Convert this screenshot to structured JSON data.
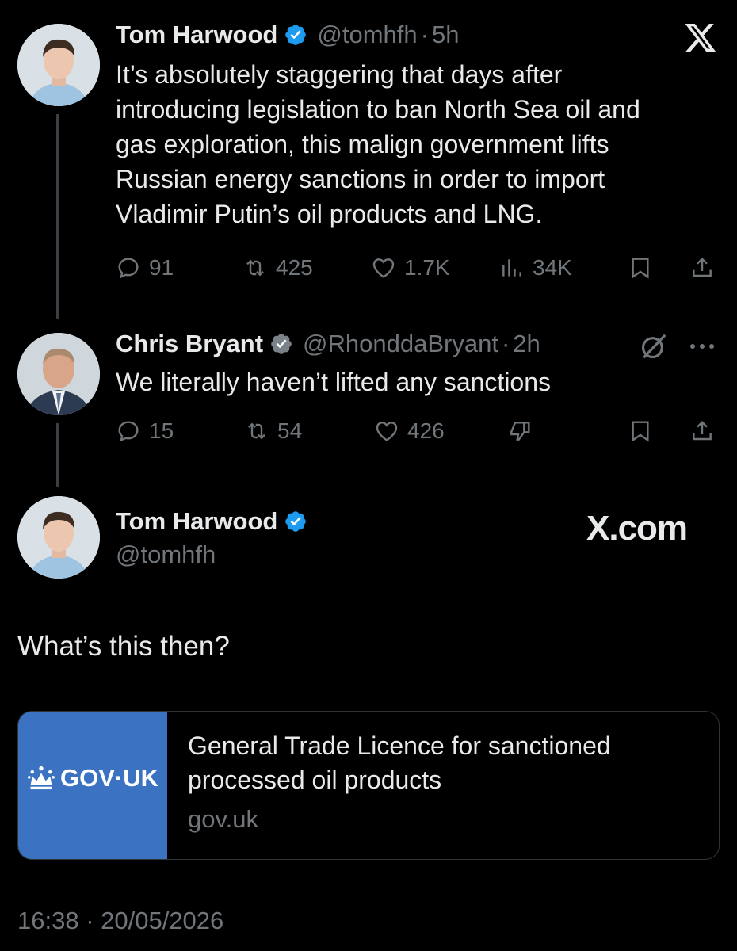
{
  "tweet1": {
    "name": "Tom Harwood",
    "handle": "@tomhfh",
    "time": "5h",
    "text_lines": [
      "It’s absolutely staggering that days after",
      "introducing legislation to ban North Sea oil and",
      "gas exploration, this malign government lifts",
      "Russian energy sanctions in order to import",
      "Vladimir Putin’s oil products and LNG."
    ],
    "replies": "91",
    "reposts": "425",
    "likes": "1.7K",
    "views": "34K"
  },
  "tweet2": {
    "name": "Chris Bryant",
    "handle": "@RhonddaBryant",
    "time": "2h",
    "text": "We literally haven’t lifted any sanctions",
    "replies": "15",
    "reposts": "54",
    "likes": "426"
  },
  "tweet3": {
    "name": "Tom Harwood",
    "handle": "@tomhfh",
    "watermark": "X.com",
    "text": "What’s this then?",
    "card": {
      "logo_text": "GOV·UK",
      "title_lines": [
        "General Trade Licence for sanctioned",
        "processed oil products"
      ],
      "domain": "gov.uk"
    },
    "timestamp": "16:38 · 20/05/2026"
  },
  "icons": [
    "x-logo-icon",
    "verified-badge-icon",
    "reply-icon",
    "repost-icon",
    "like-icon",
    "views-icon",
    "bookmark-icon",
    "share-icon",
    "grok-icon",
    "more-icon",
    "dislike-icon",
    "crown-icon"
  ],
  "colors": {
    "background": "#000000",
    "text": "#e7e9ea",
    "muted": "#71767b",
    "verified": "#1d9bf0",
    "govuk_blue": "#3b73c2"
  }
}
